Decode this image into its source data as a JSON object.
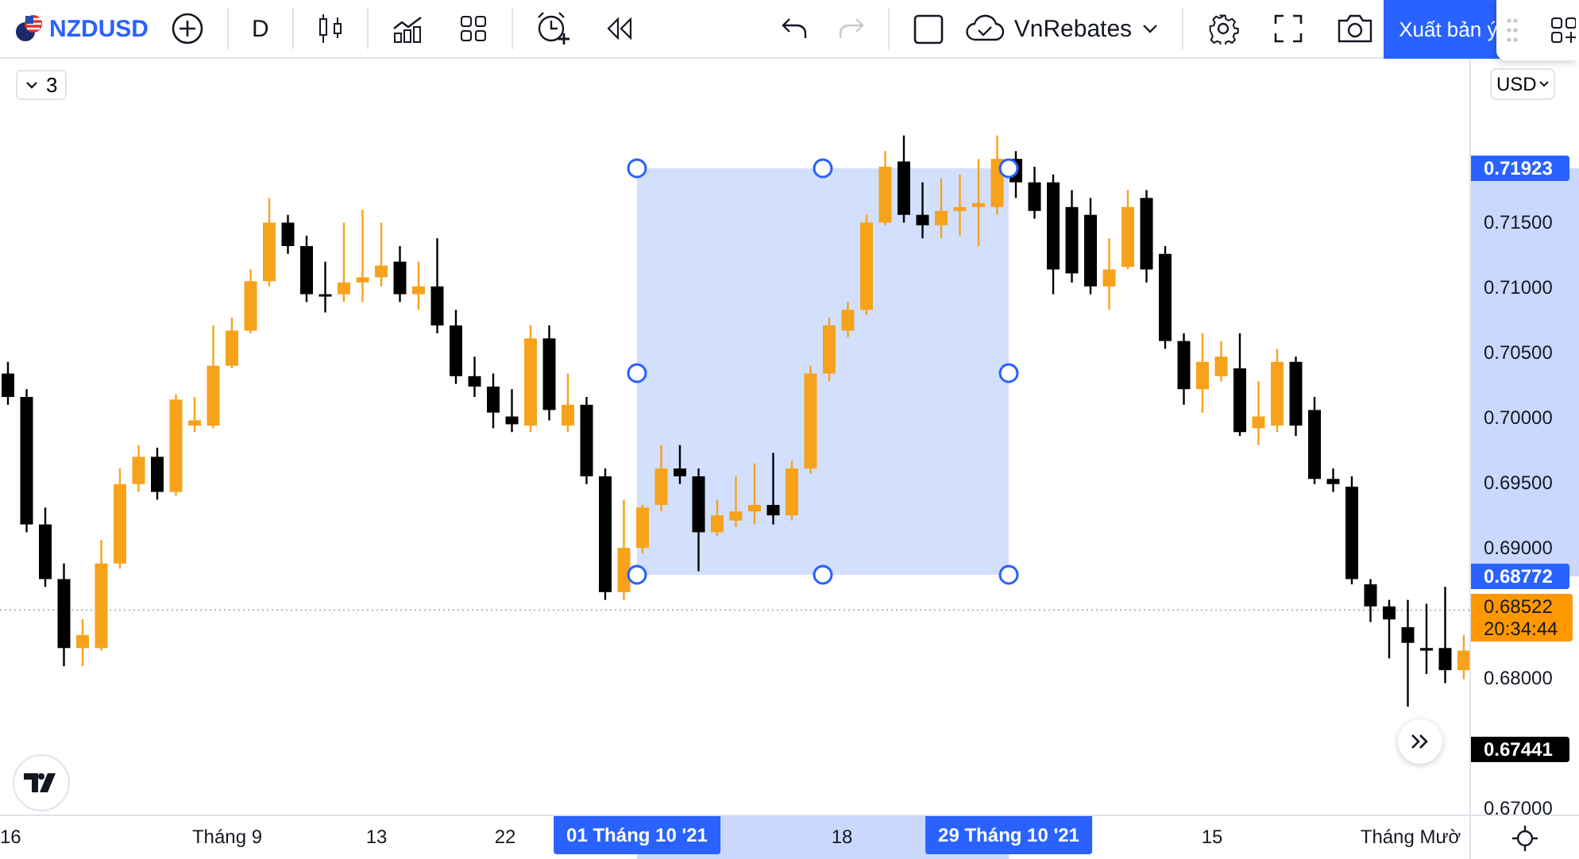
{
  "toolbar": {
    "symbol": "NZDUSD",
    "interval": "D",
    "account": "VnRebates",
    "publish_button": "Xuất bản ý",
    "redo_disabled": true
  },
  "legend_toggle": {
    "count": "3"
  },
  "chart": {
    "chart_data": {
      "type": "candlestick",
      "ylim": [
        0.6695,
        0.7276
      ],
      "ref_lines": [
        {
          "axis": "y",
          "value": 0.68522,
          "label": "0.68522"
        }
      ],
      "yticks": [
        {
          "value": 0.715,
          "label": "0.71500"
        },
        {
          "value": 0.71,
          "label": "0.71000"
        },
        {
          "value": 0.705,
          "label": "0.70500"
        },
        {
          "value": 0.7,
          "label": "0.70000"
        },
        {
          "value": 0.695,
          "label": "0.69500"
        },
        {
          "value": 0.69,
          "label": "0.69000"
        },
        {
          "value": 0.68,
          "label": "0.68000"
        },
        {
          "value": 0.67,
          "label": "0.67000"
        }
      ],
      "categories": [
        null,
        null,
        null,
        null,
        null,
        null,
        null,
        null,
        null,
        null,
        null,
        null,
        null,
        null,
        null,
        null,
        null,
        null,
        null,
        null,
        null,
        null,
        null,
        null,
        null,
        null,
        null,
        null,
        null,
        null,
        null,
        null,
        null,
        null,
        null,
        null,
        null,
        null,
        null,
        null,
        null,
        null,
        null,
        null,
        null,
        null,
        null,
        null,
        null,
        null,
        null,
        null,
        null,
        null,
        null,
        null,
        null,
        null,
        null,
        null,
        null,
        null,
        null,
        null,
        null,
        null,
        null,
        null,
        null,
        null,
        null,
        null,
        null,
        null,
        null,
        null,
        null,
        null,
        null
      ],
      "ohlc": [
        [
          0.7034,
          0.7043,
          0.701,
          0.7016
        ],
        [
          0.7016,
          0.7022,
          0.6912,
          0.6918
        ],
        [
          0.6918,
          0.6931,
          0.687,
          0.6876
        ],
        [
          0.6876,
          0.6888,
          0.6809,
          0.6823
        ],
        [
          0.6823,
          0.6845,
          0.6809,
          0.6833
        ],
        [
          0.6823,
          0.6906,
          0.6821,
          0.6888
        ],
        [
          0.6888,
          0.6961,
          0.6884,
          0.6949
        ],
        [
          0.6949,
          0.6979,
          0.6943,
          0.697
        ],
        [
          0.697,
          0.6977,
          0.6937,
          0.6943
        ],
        [
          0.6943,
          0.7018,
          0.694,
          0.7014
        ],
        [
          0.6994,
          0.7016,
          0.6989,
          0.6998
        ],
        [
          0.6994,
          0.7071,
          0.6992,
          0.704
        ],
        [
          0.704,
          0.7077,
          0.7038,
          0.7067
        ],
        [
          0.7067,
          0.7114,
          0.7065,
          0.7105
        ],
        [
          0.7105,
          0.7169,
          0.7101,
          0.715
        ],
        [
          0.715,
          0.7156,
          0.7126,
          0.7132
        ],
        [
          0.7132,
          0.714,
          0.7089,
          0.7095
        ],
        [
          0.7095,
          0.712,
          0.7081,
          0.7094
        ],
        [
          0.7095,
          0.715,
          0.7089,
          0.7104
        ],
        [
          0.7104,
          0.716,
          0.7089,
          0.7108
        ],
        [
          0.7108,
          0.715,
          0.7101,
          0.7117
        ],
        [
          0.712,
          0.7132,
          0.7089,
          0.7095
        ],
        [
          0.7095,
          0.712,
          0.7083,
          0.7101
        ],
        [
          0.7101,
          0.7138,
          0.7065,
          0.7071
        ],
        [
          0.7071,
          0.7083,
          0.7026,
          0.7032
        ],
        [
          0.7032,
          0.7047,
          0.7016,
          0.7024
        ],
        [
          0.7024,
          0.7034,
          0.6992,
          0.7004
        ],
        [
          0.7001,
          0.7022,
          0.6989,
          0.6995
        ],
        [
          0.6994,
          0.7071,
          0.6989,
          0.7061
        ],
        [
          0.7061,
          0.7071,
          0.6998,
          0.7006
        ],
        [
          0.6994,
          0.7034,
          0.6989,
          0.701
        ],
        [
          0.701,
          0.7016,
          0.6949,
          0.6955
        ],
        [
          0.6955,
          0.6961,
          0.686,
          0.6866
        ],
        [
          0.6866,
          0.6937,
          0.686,
          0.69
        ],
        [
          0.69,
          0.6933,
          0.6896,
          0.6931
        ],
        [
          0.6933,
          0.6979,
          0.6928,
          0.6961
        ],
        [
          0.6961,
          0.6979,
          0.6949,
          0.6955
        ],
        [
          0.6955,
          0.6961,
          0.6882,
          0.6912
        ],
        [
          0.6912,
          0.6937,
          0.6909,
          0.6925
        ],
        [
          0.6921,
          0.6955,
          0.6916,
          0.6928
        ],
        [
          0.6928,
          0.6965,
          0.6918,
          0.6933
        ],
        [
          0.6933,
          0.6973,
          0.6918,
          0.6925
        ],
        [
          0.6925,
          0.6967,
          0.6921,
          0.6961
        ],
        [
          0.6961,
          0.704,
          0.6957,
          0.7034
        ],
        [
          0.7034,
          0.7077,
          0.7028,
          0.7071
        ],
        [
          0.7067,
          0.7089,
          0.7062,
          0.7083
        ],
        [
          0.7083,
          0.7156,
          0.7079,
          0.715
        ],
        [
          0.715,
          0.7205,
          0.7148,
          0.7193
        ],
        [
          0.7197,
          0.7217,
          0.715,
          0.7156
        ],
        [
          0.7156,
          0.7181,
          0.7138,
          0.7148
        ],
        [
          0.7148,
          0.7184,
          0.7138,
          0.7159
        ],
        [
          0.7159,
          0.7187,
          0.714,
          0.7162
        ],
        [
          0.7162,
          0.7199,
          0.7132,
          0.7165
        ],
        [
          0.7162,
          0.7217,
          0.7156,
          0.7199
        ],
        [
          0.7199,
          0.7205,
          0.7169,
          0.7181
        ],
        [
          0.7181,
          0.7193,
          0.7153,
          0.7159
        ],
        [
          0.7181,
          0.7187,
          0.7095,
          0.7114
        ],
        [
          0.7162,
          0.7175,
          0.7104,
          0.7111
        ],
        [
          0.7156,
          0.7169,
          0.7095,
          0.7101
        ],
        [
          0.7101,
          0.7138,
          0.7083,
          0.7114
        ],
        [
          0.7116,
          0.7175,
          0.7114,
          0.7162
        ],
        [
          0.7169,
          0.7175,
          0.7104,
          0.7114
        ],
        [
          0.7126,
          0.7132,
          0.7053,
          0.7059
        ],
        [
          0.7059,
          0.7065,
          0.701,
          0.7022
        ],
        [
          0.7022,
          0.7065,
          0.7004,
          0.7043
        ],
        [
          0.7032,
          0.7059,
          0.7028,
          0.7047
        ],
        [
          0.7038,
          0.7065,
          0.6986,
          0.6989
        ],
        [
          0.6992,
          0.7028,
          0.6979,
          0.7001
        ],
        [
          0.6994,
          0.7053,
          0.6989,
          0.7043
        ],
        [
          0.7043,
          0.7047,
          0.6986,
          0.6994
        ],
        [
          0.7006,
          0.7016,
          0.6949,
          0.6953
        ],
        [
          0.6953,
          0.6961,
          0.6943,
          0.6949
        ],
        [
          0.6947,
          0.6955,
          0.6872,
          0.6876
        ],
        [
          0.6872,
          0.6876,
          0.6843,
          0.6855
        ],
        [
          0.6855,
          0.686,
          0.6815,
          0.6845
        ],
        [
          0.6839,
          0.686,
          0.6778,
          0.6827
        ],
        [
          0.6823,
          0.6857,
          0.6803,
          0.6821
        ],
        [
          0.6823,
          0.687,
          0.6796,
          0.6806
        ],
        [
          0.6806,
          0.6833,
          0.6799,
          0.6821
        ]
      ]
    }
  },
  "price_axis": {
    "currency": "USD",
    "labels": [
      {
        "kind": "selection",
        "text": "0.71923"
      },
      {
        "kind": "selection",
        "text": "0.68772"
      },
      {
        "kind": "current",
        "countdown": "20:34:44"
      },
      {
        "kind": "last",
        "text": "0.67441"
      }
    ]
  },
  "time_axis": {
    "ticks": [
      {
        "kind": "tick",
        "label": "16"
      },
      {
        "kind": "tick",
        "label": "Tháng 9"
      },
      {
        "kind": "tick",
        "label": "13"
      },
      {
        "kind": "tick",
        "label": "22"
      },
      {
        "kind": "selection",
        "label": "01 Tháng 10 '21"
      },
      {
        "kind": "tick",
        "label": "18"
      },
      {
        "kind": "selection",
        "label": "29 Tháng 10 '21"
      },
      {
        "kind": "tick",
        "label": "15"
      },
      {
        "kind": "tick",
        "label": "Tháng Mườ"
      }
    ]
  }
}
